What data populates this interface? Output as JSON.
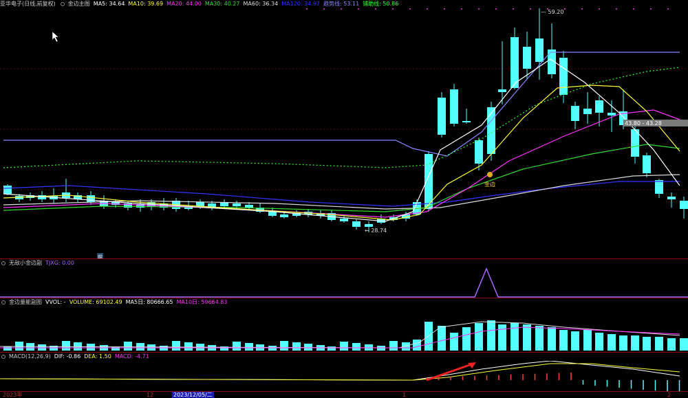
{
  "main_panel": {
    "stock_name": "亚华电子(日线,前复权)",
    "indicator_name": "金边主图",
    "items": [
      {
        "label": "MA5: 34.64",
        "color": "#ffffff"
      },
      {
        "label": "MA10: 39.69",
        "color": "#ffff33"
      },
      {
        "label": "MA20: 44.00",
        "color": "#ff33ff"
      },
      {
        "label": "MA30: 40.27",
        "color": "#33dd33"
      },
      {
        "label": "MA60: 36.34",
        "color": "#dddddd"
      },
      {
        "label": "MA120: 34.97",
        "color": "#3333ff"
      },
      {
        "label": "趋势线: 53.11",
        "color": "#8888ff"
      },
      {
        "label": "铺助线: 50.86",
        "color": "#33ff33"
      }
    ],
    "high_label": "59.20",
    "low_label": "28.74",
    "gold_edge_label": "金边",
    "price_range_label": "43.80 - 43.28"
  },
  "sub_panel_1": {
    "title": "无敌小金边副",
    "value_label": "TJXG: 0.00",
    "value_color": "#aa66ff"
  },
  "sub_panel_2": {
    "title": "金边量能副图",
    "items": [
      {
        "label": "VVOL: -",
        "color": "#ffffff"
      },
      {
        "label": "VOLUME: 69102.49",
        "color": "#ffff33"
      },
      {
        "label": "MA5日: 80666.65",
        "color": "#ffffff"
      },
      {
        "label": "MA10日: 59664.83",
        "color": "#ff33ff"
      }
    ]
  },
  "sub_panel_3": {
    "title": "MACD(12,26,9)",
    "items": [
      {
        "label": "DIF: -0.86",
        "color": "#ffffff"
      },
      {
        "label": "DEA: 1.50",
        "color": "#ffff33"
      },
      {
        "label": "MACD: -4.71",
        "color": "#ff33ff"
      }
    ]
  },
  "x_axis": {
    "labels": [
      "2023年",
      "12",
      "1",
      "2"
    ],
    "highlight": "2023/12/05/二"
  },
  "marker_text": "前",
  "colors": {
    "up": "#ff4444",
    "down": "#54ffff",
    "ma5": "#ffffff",
    "ma10": "#ffff33",
    "ma20": "#ff33ff",
    "ma30": "#33dd33",
    "ma60": "#dddddd",
    "ma120": "#3333ff",
    "trend": "#8888ff",
    "assist": "#33ff33"
  }
}
